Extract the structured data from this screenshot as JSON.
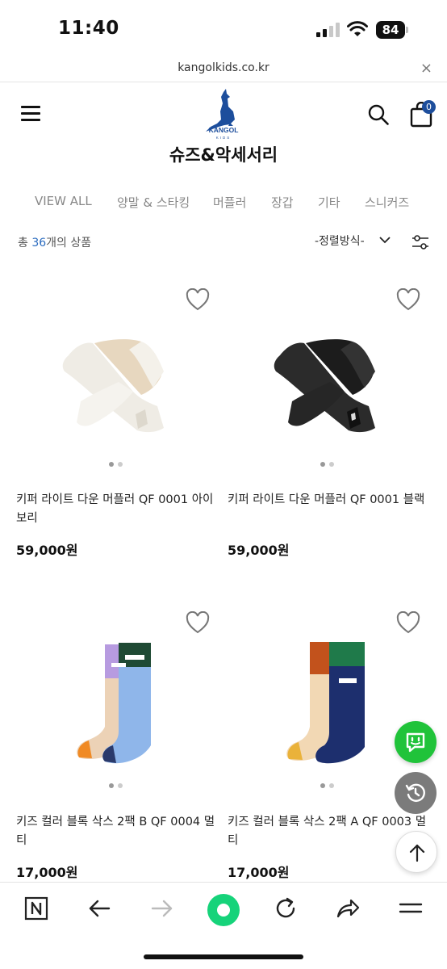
{
  "status_bar": {
    "time": "11:40",
    "battery": "84"
  },
  "url_bar": {
    "url": "kangolkids.co.kr",
    "close": "×"
  },
  "header": {
    "title": "슈즈&악세서리",
    "cart_count": "0",
    "logo_text": "KANGOL",
    "logo_sub": "KIDS"
  },
  "categories": [
    "VIEW ALL",
    "양말 & 스타킹",
    "머플러",
    "장갑",
    "기타",
    "스니커즈"
  ],
  "listing": {
    "count_prefix": "총 ",
    "count": "36",
    "count_suffix": "개의 상품",
    "sort_label": "-정렬방식-"
  },
  "products": [
    {
      "name": "키퍼 라이트 다운 머플러 QF 0001 아이보리",
      "price": "59,000원",
      "image": "ivory-scarf"
    },
    {
      "name": "키퍼 라이트 다운 머플러 QF 0001 블랙",
      "price": "59,000원",
      "image": "black-scarf"
    },
    {
      "name": "키즈 컬러 블록 삭스 2팩 B QF 0004 멀티",
      "price": "17,000원",
      "image": "socks-b"
    },
    {
      "name": "키즈 컬러 블록 삭스 2팩 A QF 0003 멀티",
      "price": "17,000원",
      "image": "socks-a"
    }
  ],
  "colors": {
    "brand_blue": "#1d4e9c",
    "chat_green": "#20c33a",
    "count_blue": "#2a6bbf",
    "naver_green": "#16d37a"
  },
  "icons": [
    "hamburger-menu-icon",
    "search-icon",
    "shopping-bag-icon",
    "heart-icon",
    "filter-icon",
    "chat-icon",
    "history-icon",
    "arrow-up-icon",
    "naver-n-icon",
    "back-arrow-icon",
    "forward-arrow-icon",
    "refresh-icon",
    "share-icon",
    "menu-lines-icon"
  ]
}
